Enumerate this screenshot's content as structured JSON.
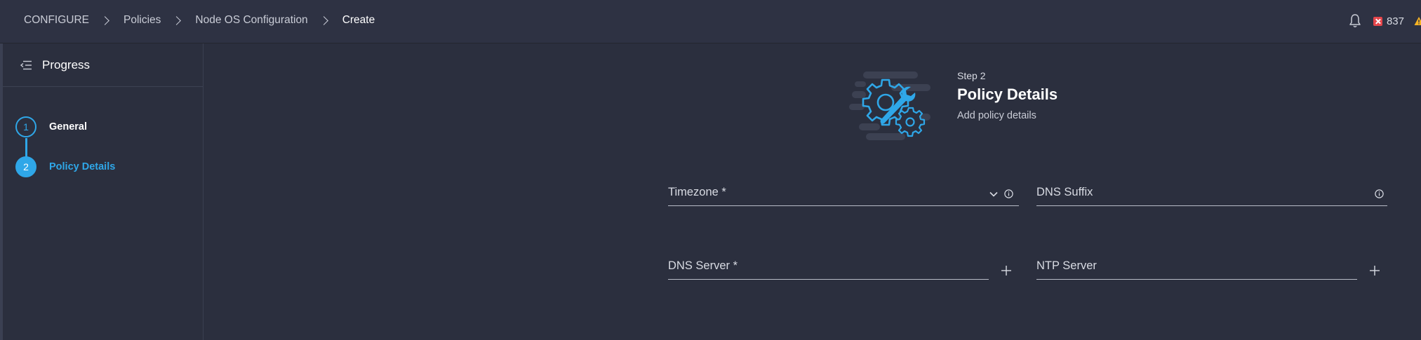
{
  "breadcrumb": {
    "items": [
      "CONFIGURE",
      "Policies",
      "Node OS Configuration",
      "Create"
    ]
  },
  "header": {
    "error_count": "837",
    "icons": [
      "bell-icon",
      "error-icon",
      "warning-icon"
    ]
  },
  "sidebar": {
    "title": "Progress",
    "steps": [
      {
        "number": "1",
        "label": "General",
        "state": "completed"
      },
      {
        "number": "2",
        "label": "Policy Details",
        "state": "active"
      }
    ]
  },
  "main": {
    "step_caption": "Step 2",
    "title": "Policy Details",
    "subtitle": "Add policy details",
    "fields": {
      "timezone": {
        "label": "Timezone *",
        "value": ""
      },
      "dns_suffix": {
        "label": "DNS Suffix",
        "value": ""
      },
      "dns_server": {
        "label": "DNS Server *",
        "value": ""
      },
      "ntp_server": {
        "label": "NTP Server",
        "value": ""
      }
    }
  },
  "colors": {
    "accent": "#2fa7e8",
    "background": "#2b2f3e",
    "topbar": "#2e3243",
    "error": "#e5464b",
    "warning": "#f5b324"
  }
}
